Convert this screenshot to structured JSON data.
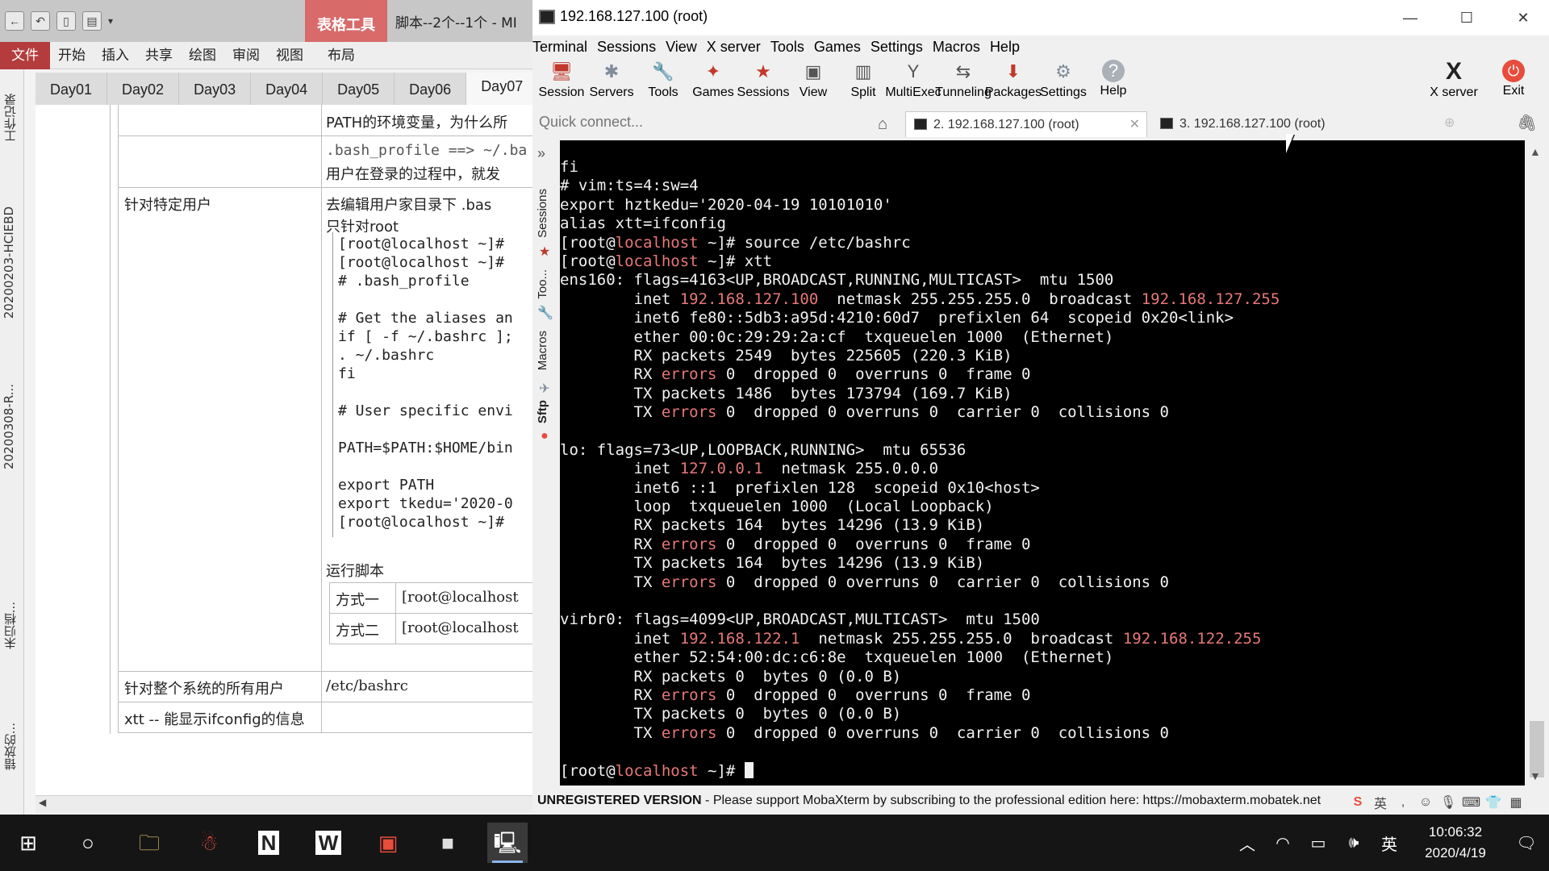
{
  "office": {
    "table_tools": "表格工具",
    "doc_title": "脚本--2个--1个 - MI",
    "ribbon_tabs": [
      "文件",
      "开始",
      "插入",
      "共享",
      "绘图",
      "审阅",
      "视图",
      "布局"
    ],
    "side_labels": [
      "工作记录",
      "20200203-HCIEBD",
      "20200308-R...",
      "未归档...",
      "错放的..."
    ],
    "sections": [
      "Day01",
      "Day02",
      "Day03",
      "Day04",
      "Day05",
      "Day06",
      "Day07"
    ],
    "active_section": "Day07",
    "rows": {
      "path_env": "PATH的环境变量，为什么所",
      "bash_profile_mono": ".bash_profile ==> ~/.ba",
      "login_text": "用户在登录的过程中，就发",
      "specific_user_label": "针对特定用户",
      "edit_home": "去编辑用户家目录下 .bas",
      "only_root": "只针对root",
      "run_script": "运行脚本",
      "method_one": "方式一",
      "method_two": "方式二",
      "method_one_cmd": "[root@localhost",
      "method_two_cmd": "[root@localhost",
      "all_users_label": "针对整个系统的所有用户",
      "all_users_value": "/etc/bashrc",
      "xtt_note": "xtt -- 能显示ifconfig的信息"
    },
    "code_lines": [
      "[root@localhost ~]#",
      "[root@localhost ~]#",
      "# .bash_profile",
      "",
      "# Get the aliases an",
      "if [ -f ~/.bashrc ];",
      "        . ~/.bashrc",
      "fi",
      "",
      "# User specific envi",
      "",
      "PATH=$PATH:$HOME/bin",
      "",
      "export PATH",
      "export tkedu='2020-0",
      "[root@localhost ~]#"
    ]
  },
  "moba": {
    "title": "192.168.127.100 (root)",
    "menu": [
      "Terminal",
      "Sessions",
      "View",
      "X server",
      "Tools",
      "Games",
      "Settings",
      "Macros",
      "Help"
    ],
    "toolbar": [
      {
        "label": "Session",
        "icon": "session-icon",
        "glyph": "🖥"
      },
      {
        "label": "Servers",
        "icon": "servers-icon",
        "glyph": "✱"
      },
      {
        "label": "Tools",
        "icon": "tools-icon",
        "glyph": "🔧"
      },
      {
        "label": "Games",
        "icon": "games-icon",
        "glyph": "✦"
      },
      {
        "label": "Sessions",
        "icon": "sessions-star-icon",
        "glyph": "★"
      },
      {
        "label": "View",
        "icon": "view-icon",
        "glyph": "▣"
      },
      {
        "label": "Split",
        "icon": "split-icon",
        "glyph": "▥"
      },
      {
        "label": "MultiExec",
        "icon": "multiexec-icon",
        "glyph": "Y"
      },
      {
        "label": "Tunneling",
        "icon": "tunneling-icon",
        "glyph": "⇆"
      },
      {
        "label": "Packages",
        "icon": "packages-icon",
        "glyph": "⬇"
      },
      {
        "label": "Settings",
        "icon": "settings-gear-icon",
        "glyph": "⚙"
      },
      {
        "label": "Help",
        "icon": "help-icon",
        "glyph": "?"
      }
    ],
    "xserver_label": "X server",
    "exit_label": "Exit",
    "quick_connect_placeholder": "Quick connect...",
    "tabs": [
      "2. 192.168.127.100 (root)",
      "3. 192.168.127.100 (root)"
    ],
    "side_tabs": [
      "Sessions",
      "Too...",
      "Macros",
      "Sftp"
    ],
    "status_bold": "UNREGISTERED VERSION",
    "status_text": " -  Please support MobaXterm by subscribing to the professional edition here:  https://mobaxterm.mobatek.net",
    "terminal_color_accent": "#e77878"
  },
  "terminal": {
    "lines": [
      [
        {
          "t": "fi"
        }
      ],
      [
        {
          "t": "# vim:ts=4:sw=4"
        }
      ],
      [
        {
          "t": "export hztkedu='2020-04-19 10101010'"
        }
      ],
      [
        {
          "t": "alias xtt=ifconfig"
        }
      ],
      [
        {
          "t": "[root@"
        },
        {
          "t": "localhost",
          "c": "red"
        },
        {
          "t": " ~]# source /etc/bashrc"
        }
      ],
      [
        {
          "t": "[root@"
        },
        {
          "t": "localhost",
          "c": "red"
        },
        {
          "t": " ~]# xtt"
        }
      ],
      [
        {
          "t": "ens160: flags=4163<UP,BROADCAST,RUNNING,MULTICAST>  mtu 1500"
        }
      ],
      [
        {
          "t": "        inet "
        },
        {
          "t": "192.168.127.100",
          "c": "red"
        },
        {
          "t": "  netmask 255.255.255.0  broadcast "
        },
        {
          "t": "192.168.127.255",
          "c": "red"
        }
      ],
      [
        {
          "t": "        inet6 fe80::5db3:a95d:4210:60d7  prefixlen 64  scopeid 0x20<link>"
        }
      ],
      [
        {
          "t": "        ether 00:0c:29:29:2a:cf  txqueuelen 1000  (Ethernet)"
        }
      ],
      [
        {
          "t": "        RX packets 2549  bytes 225605 (220.3 KiB)"
        }
      ],
      [
        {
          "t": "        RX "
        },
        {
          "t": "errors",
          "c": "red"
        },
        {
          "t": " 0  dropped 0  overruns 0  frame 0"
        }
      ],
      [
        {
          "t": "        TX packets 1486  bytes 173794 (169.7 KiB)"
        }
      ],
      [
        {
          "t": "        TX "
        },
        {
          "t": "errors",
          "c": "red"
        },
        {
          "t": " 0  dropped 0 overruns 0  carrier 0  collisions 0"
        }
      ],
      [
        {
          "t": ""
        }
      ],
      [
        {
          "t": "lo: flags=73<UP,LOOPBACK,RUNNING>  mtu 65536"
        }
      ],
      [
        {
          "t": "        inet "
        },
        {
          "t": "127.0.0.1",
          "c": "red"
        },
        {
          "t": "  netmask 255.0.0.0"
        }
      ],
      [
        {
          "t": "        inet6 ::1  prefixlen 128  scopeid 0x10<host>"
        }
      ],
      [
        {
          "t": "        loop  txqueuelen 1000  (Local Loopback)"
        }
      ],
      [
        {
          "t": "        RX packets 164  bytes 14296 (13.9 KiB)"
        }
      ],
      [
        {
          "t": "        RX "
        },
        {
          "t": "errors",
          "c": "red"
        },
        {
          "t": " 0  dropped 0  overruns 0  frame 0"
        }
      ],
      [
        {
          "t": "        TX packets 164  bytes 14296 (13.9 KiB)"
        }
      ],
      [
        {
          "t": "        TX "
        },
        {
          "t": "errors",
          "c": "red"
        },
        {
          "t": " 0  dropped 0 overruns 0  carrier 0  collisions 0"
        }
      ],
      [
        {
          "t": ""
        }
      ],
      [
        {
          "t": "virbr0: flags=4099<UP,BROADCAST,MULTICAST>  mtu 1500"
        }
      ],
      [
        {
          "t": "        inet "
        },
        {
          "t": "192.168.122.1",
          "c": "red"
        },
        {
          "t": "  netmask 255.255.255.0  broadcast "
        },
        {
          "t": "192.168.122.255",
          "c": "red"
        }
      ],
      [
        {
          "t": "        ether 52:54:00:dc:c6:8e  txqueuelen 1000  (Ethernet)"
        }
      ],
      [
        {
          "t": "        RX packets 0  bytes 0 (0.0 B)"
        }
      ],
      [
        {
          "t": "        RX "
        },
        {
          "t": "errors",
          "c": "red"
        },
        {
          "t": " 0  dropped 0  overruns 0  frame 0"
        }
      ],
      [
        {
          "t": "        TX packets 0  bytes 0 (0.0 B)"
        }
      ],
      [
        {
          "t": "        TX "
        },
        {
          "t": "errors",
          "c": "red"
        },
        {
          "t": " 0  dropped 0 overruns 0  carrier 0  collisions 0"
        }
      ],
      [
        {
          "t": ""
        }
      ],
      [
        {
          "t": "[root@"
        },
        {
          "t": "localhost",
          "c": "red"
        },
        {
          "t": " ~]# "
        },
        {
          "cursor": true
        }
      ]
    ]
  },
  "taskbar": {
    "time": "10:06:32",
    "date": "2020/4/19",
    "ime": "英"
  }
}
